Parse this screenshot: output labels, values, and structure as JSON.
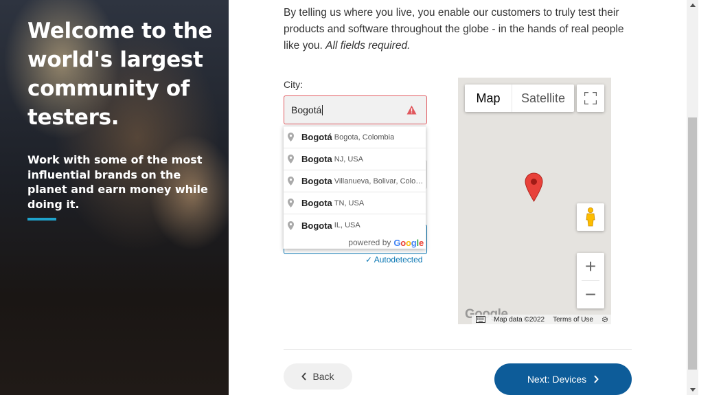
{
  "hero": {
    "title": "Welcome to the world's largest community of testers.",
    "subtitle": "Work with some of the most influential brands on the planet and earn money while doing it."
  },
  "intro": {
    "text": "By telling us where you live, you enable our customers to truly test their products and software throughout the globe - in the hands of real people like you. ",
    "emphasis": "All fields required."
  },
  "city": {
    "label": "City:",
    "value": "Bogotá",
    "status": "error"
  },
  "autocomplete": {
    "items": [
      {
        "main": "Bogotá",
        "secondary": "Bogota, Colombia"
      },
      {
        "main": "Bogota",
        "secondary": "NJ, USA"
      },
      {
        "main": "Bogota",
        "secondary": "Villanueva, Bolivar, Colombia"
      },
      {
        "main": "Bogota",
        "secondary": "TN, USA"
      },
      {
        "main": "Bogota",
        "secondary": "IL, USA"
      }
    ],
    "powered_by": "powered by",
    "brand": "Google"
  },
  "autodetected": "✓ Autodetected",
  "map": {
    "type_map": "Map",
    "type_satellite": "Satellite",
    "zoom_in": "+",
    "zoom_out": "−",
    "logo": "Google",
    "data": "Map data ©2022",
    "terms": "Terms of Use"
  },
  "buttons": {
    "back": "Back",
    "next": "Next: Devices"
  },
  "colors": {
    "accent": "#1fa3cc",
    "primary_button": "#0d5c99",
    "error": "#e0575d",
    "link": "#0a77b3"
  }
}
